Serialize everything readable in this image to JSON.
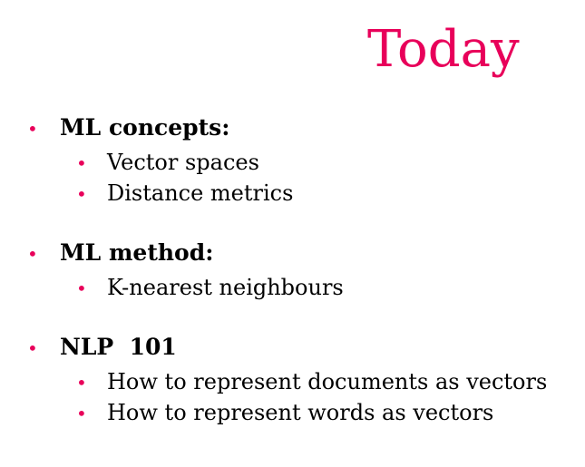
{
  "title": "Today",
  "colors": {
    "accent": "#e8005a",
    "text": "#000000",
    "background": "#ffffff"
  },
  "bullet_glyph": "•",
  "sections": [
    {
      "heading": "ML concepts:",
      "items": [
        "Vector spaces",
        "Distance metrics"
      ]
    },
    {
      "heading": "ML method:",
      "items": [
        "K-nearest neighbours"
      ]
    },
    {
      "heading": "NLP  101",
      "items": [
        "How to represent documents as vectors",
        "How to represent words as vectors"
      ]
    }
  ]
}
